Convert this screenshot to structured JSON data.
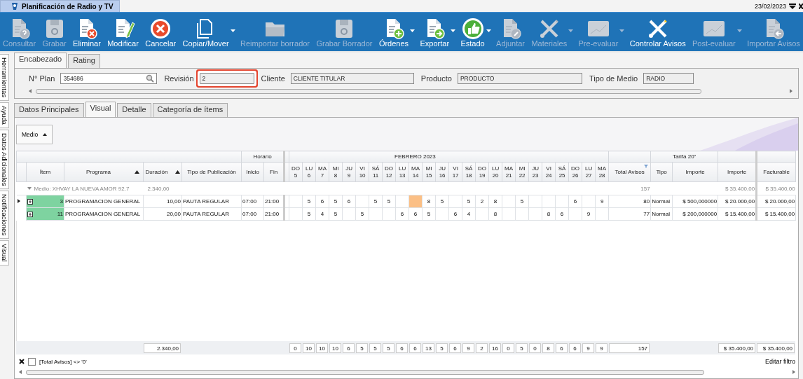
{
  "app_tab": {
    "title": "Planificación de Radio y TV"
  },
  "date": "23/02/2023",
  "toolbar": [
    {
      "label": "Consultar",
      "disabled": true,
      "dropdown": false
    },
    {
      "label": "Grabar",
      "disabled": true,
      "dropdown": false
    },
    {
      "label": "Eliminar",
      "disabled": false,
      "dropdown": false
    },
    {
      "label": "Modificar",
      "disabled": false,
      "dropdown": false
    },
    {
      "label": "Cancelar",
      "disabled": false,
      "dropdown": false
    },
    {
      "label": "Copiar/Mover",
      "disabled": false,
      "dropdown": true
    },
    {
      "label": "Reimportar borrador",
      "disabled": true,
      "dropdown": false
    },
    {
      "label": "Grabar Borrador",
      "disabled": true,
      "dropdown": false
    },
    {
      "label": "Órdenes",
      "disabled": false,
      "dropdown": true
    },
    {
      "label": "Exportar",
      "disabled": false,
      "dropdown": true
    },
    {
      "label": "Estado",
      "disabled": false,
      "dropdown": true
    },
    {
      "label": "Adjuntar",
      "disabled": true,
      "dropdown": false
    },
    {
      "label": "Materiales",
      "disabled": true,
      "dropdown": true
    },
    {
      "label": "Pre-evaluar",
      "disabled": true,
      "dropdown": true
    },
    {
      "label": "Controlar Avisos",
      "disabled": false,
      "dropdown": false
    },
    {
      "label": "Post-evaluar",
      "disabled": true,
      "dropdown": true
    },
    {
      "label": "Importar Avisos",
      "disabled": true,
      "dropdown": false
    }
  ],
  "side_tabs": [
    "Herramientas",
    "Ayuda",
    "Datos Adicionales",
    "Notificaciones",
    "Visual"
  ],
  "header_tabs": [
    {
      "label": "Encabezado",
      "selected": true
    },
    {
      "label": "Rating",
      "selected": false
    }
  ],
  "header_fields": [
    {
      "label": "N° Plan",
      "value": "354686",
      "kind": "search",
      "highlighted": false
    },
    {
      "label": "Revisión",
      "value": "2",
      "kind": "readonly",
      "highlighted": true
    },
    {
      "label": "Cliente",
      "value": "CLIENTE TITULAR",
      "kind": "readonly",
      "highlighted": false
    },
    {
      "label": "Producto",
      "value": "PRODUCTO",
      "kind": "readonly",
      "highlighted": false
    },
    {
      "label": "Tipo de Medio",
      "value": "RADIO",
      "kind": "readonly",
      "highlighted": false
    }
  ],
  "detail_tabs": [
    {
      "label": "Datos Principales",
      "selected": false
    },
    {
      "label": "Visual",
      "selected": true
    },
    {
      "label": "Detalle",
      "selected": false
    },
    {
      "label": "Categoría de ítems",
      "selected": false
    }
  ],
  "group_button": {
    "label": "Medio"
  },
  "grid": {
    "horario": "Horario",
    "month": "FEBRERO 2023",
    "tarifa": "Tarifa 20\"",
    "columns": [
      {
        "label": "Ítem",
        "sorted": false
      },
      {
        "label": "Programa",
        "sorted": true
      },
      {
        "label": "Duración",
        "sorted": true
      },
      {
        "label": "Tipo de Publicación",
        "sorted": false
      },
      {
        "label": "Inicio",
        "sorted": false
      },
      {
        "label": "Fin",
        "sorted": false
      }
    ],
    "days": [
      {
        "weekday": "DO",
        "day": "5"
      },
      {
        "weekday": "LU",
        "day": "6"
      },
      {
        "weekday": "MA",
        "day": "7"
      },
      {
        "weekday": "MI",
        "day": "8"
      },
      {
        "weekday": "JU",
        "day": "9"
      },
      {
        "weekday": "VI",
        "day": "10"
      },
      {
        "weekday": "SÁ",
        "day": "11"
      },
      {
        "weekday": "DO",
        "day": "12"
      },
      {
        "weekday": "LU",
        "day": "13"
      },
      {
        "weekday": "MA",
        "day": "14"
      },
      {
        "weekday": "MI",
        "day": "15"
      },
      {
        "weekday": "JU",
        "day": "16"
      },
      {
        "weekday": "VI",
        "day": "17"
      },
      {
        "weekday": "SÁ",
        "day": "18"
      },
      {
        "weekday": "DO",
        "day": "19"
      },
      {
        "weekday": "LU",
        "day": "20"
      },
      {
        "weekday": "MA",
        "day": "21"
      },
      {
        "weekday": "MI",
        "day": "22"
      },
      {
        "weekday": "JU",
        "day": "23"
      },
      {
        "weekday": "VI",
        "day": "24"
      },
      {
        "weekday": "SÁ",
        "day": "25"
      },
      {
        "weekday": "DO",
        "day": "26"
      },
      {
        "weekday": "LU",
        "day": "27"
      },
      {
        "weekday": "MA",
        "day": "28"
      }
    ],
    "trailing_columns": [
      {
        "label": "Total Avisos",
        "filtered": true
      },
      {
        "label": "Tipo",
        "filtered": false
      },
      {
        "label": "Importe",
        "filtered": false
      },
      {
        "label": "Importe",
        "filtered": false
      },
      {
        "label": "Facturable",
        "filtered": false
      }
    ],
    "group_row": {
      "label": "Medio: XHVAY LA NUEVA AMOR 92.7",
      "expanded": true,
      "duration": "2.340,00",
      "total": "157",
      "importe": "$ 35.400,00",
      "facturable": "$ 35.400,00"
    },
    "rows": [
      {
        "current": true,
        "item": "3",
        "programa": "PROGRAMACION GENERAL",
        "duracion": "10,00",
        "tipo_publicacion": "PAUTA REGULAR",
        "inicio": "07:00",
        "fin": "21:00",
        "days": [
          {
            "highlighted": false
          },
          {
            "value": "5",
            "highlighted": false
          },
          {
            "value": "6",
            "highlighted": false
          },
          {
            "value": "5",
            "highlighted": false
          },
          {
            "value": "6",
            "highlighted": false
          },
          {
            "highlighted": false
          },
          {
            "value": "5",
            "highlighted": false
          },
          {
            "value": "5",
            "highlighted": false
          },
          {
            "highlighted": false
          },
          {
            "highlighted": true
          },
          {
            "value": "8",
            "highlighted": false
          },
          {
            "value": "5",
            "highlighted": false
          },
          {
            "highlighted": false
          },
          {
            "value": "5",
            "highlighted": false
          },
          {
            "value": "2",
            "highlighted": false
          },
          {
            "value": "8",
            "highlighted": false
          },
          {
            "highlighted": false
          },
          {
            "value": "5",
            "highlighted": false
          },
          {
            "highlighted": false
          },
          {
            "highlighted": false
          },
          {
            "highlighted": false
          },
          {
            "value": "6",
            "highlighted": false
          },
          {
            "highlighted": false
          },
          {
            "value": "9",
            "highlighted": false
          }
        ],
        "total": "80",
        "tipo": "Normal",
        "tarifa_importe": "$ 500,000000",
        "importe": "$ 20.000,00",
        "facturable": "$ 20.000,00"
      },
      {
        "current": false,
        "item": "11",
        "programa": "PROGRAMACION GENERAL",
        "duracion": "20,00",
        "tipo_publicacion": "PAUTA REGULAR",
        "inicio": "07:00",
        "fin": "21:00",
        "days": [
          {
            "highlighted": false
          },
          {
            "value": "5",
            "highlighted": false
          },
          {
            "value": "4",
            "highlighted": false
          },
          {
            "value": "5",
            "highlighted": false
          },
          {
            "highlighted": false
          },
          {
            "value": "5",
            "highlighted": false
          },
          {
            "highlighted": false
          },
          {
            "highlighted": false
          },
          {
            "value": "6",
            "highlighted": false
          },
          {
            "value": "6",
            "highlighted": false
          },
          {
            "value": "5",
            "highlighted": false
          },
          {
            "highlighted": false
          },
          {
            "value": "6",
            "highlighted": false
          },
          {
            "value": "4",
            "highlighted": false
          },
          {
            "highlighted": false
          },
          {
            "value": "8",
            "highlighted": false
          },
          {
            "highlighted": false
          },
          {
            "highlighted": false
          },
          {
            "highlighted": false
          },
          {
            "value": "8",
            "highlighted": false
          },
          {
            "value": "6",
            "highlighted": false
          },
          {
            "highlighted": false
          },
          {
            "value": "9",
            "highlighted": false
          },
          {
            "highlighted": false
          }
        ],
        "total": "77",
        "tipo": "Normal",
        "tarifa_importe": "$ 200,000000",
        "importe": "$ 15.400,00",
        "facturable": "$ 15.400,00"
      }
    ],
    "totals": {
      "duration": "2.340,00",
      "days": [
        "0",
        "10",
        "10",
        "10",
        "6",
        "5",
        "5",
        "5",
        "6",
        "6",
        "13",
        "5",
        "6",
        "9",
        "2",
        "16",
        "0",
        "5",
        "0",
        "8",
        "6",
        "6",
        "9",
        "9"
      ],
      "total": "157",
      "importe": "$ 35.400,00",
      "facturable": "$ 35.400,00"
    }
  },
  "filter": {
    "text": "[Total Avisos] <> '0'",
    "checked": false,
    "edit_label": "Editar filtro"
  }
}
